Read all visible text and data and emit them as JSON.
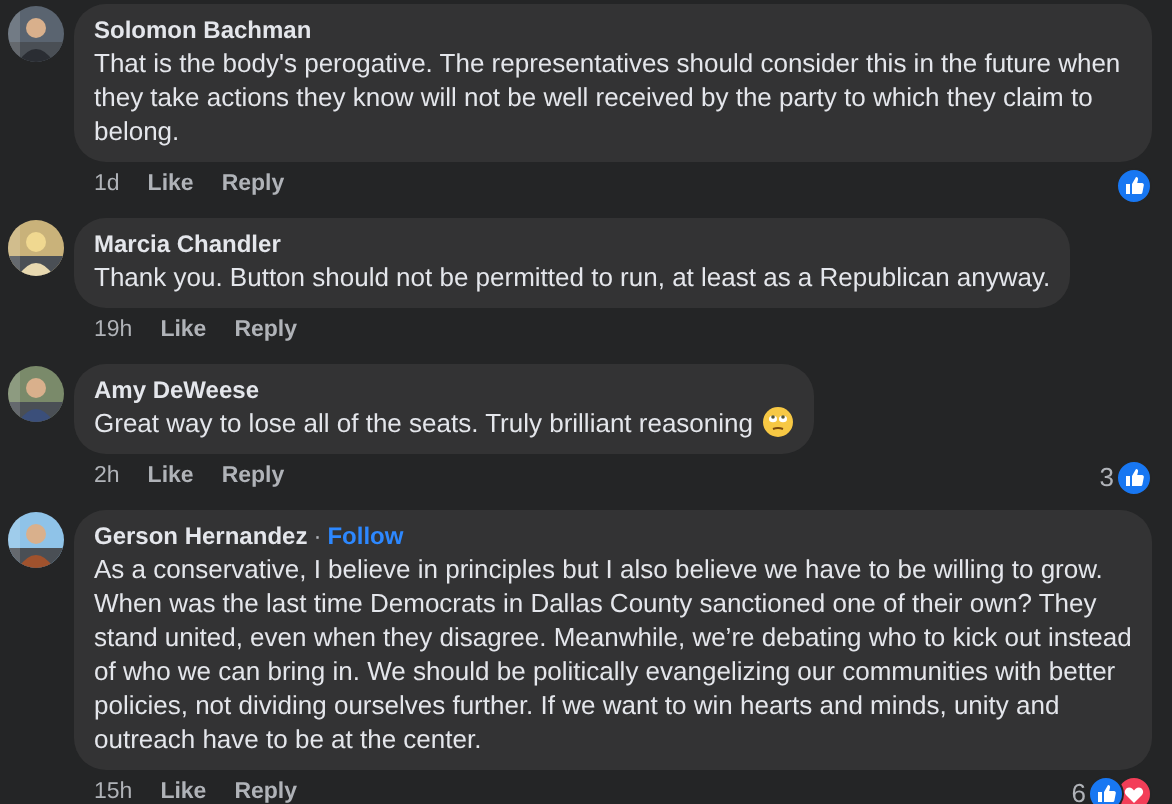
{
  "comments": [
    {
      "author": "Solomon Bachman",
      "text": "That is the body's perogative. The representatives should consider this in the future when they take actions they know will not be well received by the party to which they claim to belong.",
      "time": "1d",
      "actions": [
        "Like",
        "Reply"
      ],
      "reactions": [
        {
          "kind": "like"
        }
      ]
    },
    {
      "author": "Marcia Chandler",
      "text": "Thank you. Button should not be permitted to run, at least as a Republican anyway.",
      "time": "19h",
      "actions": [
        "Like",
        "Reply"
      ]
    },
    {
      "author": "Amy DeWeese",
      "text": "Great way to lose all of the seats. Truly brilliant reasoning",
      "kind": "emoji-end",
      "time": "2h",
      "actions": [
        "Like",
        "Reply"
      ],
      "reaction_count": "3",
      "reactions": [
        {
          "kind": "like"
        }
      ]
    },
    {
      "author": "Gerson Hernandez",
      "separator": "·",
      "follow": "Follow",
      "text": "As a conservative, I believe in principles but I also believe we have to be willing to grow. When was the last time Democrats in Dallas County sanctioned one of their own? They stand united, even when they disagree. Meanwhile, we’re debating who to kick out instead of who we can bring in. We should be politically evangelizing our communities with better policies, not dividing ourselves further. If we want to win hearts and minds, unity and outreach have to be at the center.",
      "time": "15h",
      "actions": [
        "Like",
        "Reply"
      ],
      "reaction_count": "6",
      "reactions": [
        {
          "kind": "like"
        },
        {
          "kind": "love"
        }
      ]
    }
  ]
}
